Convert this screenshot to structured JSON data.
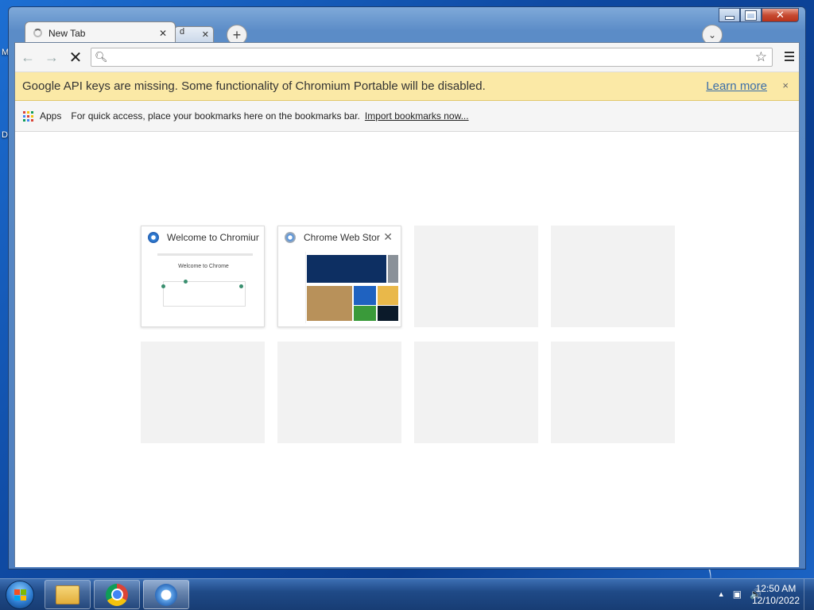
{
  "desktop": {
    "labels": [
      "My",
      "Da"
    ]
  },
  "window": {
    "controls": {
      "minimize": "",
      "maximize": "",
      "close": "✕"
    }
  },
  "tabs": [
    {
      "label": "New Tab",
      "close": "✕"
    },
    {
      "label": "d",
      "close": "✕"
    }
  ],
  "new_tab_button": "+",
  "profile_button": "⌄",
  "toolbar": {
    "back": "←",
    "forward": "→",
    "stop": "✕",
    "address_value": "",
    "star": "☆"
  },
  "infobar": {
    "message": "Google API keys are missing. Some functionality of Chromium Portable will be disabled.",
    "link": "Learn more",
    "close": "×"
  },
  "bookmarks_bar": {
    "apps_label": "Apps",
    "hint": "For quick access, place your bookmarks here on the bookmarks bar.",
    "import_link": "Import bookmarks now..."
  },
  "most_visited": [
    {
      "title": "Welcome to Chromium",
      "thumb_heading": "Welcome to Chrome"
    },
    {
      "title": "Chrome Web Store",
      "close": "✕"
    }
  ],
  "taskbar": {
    "clock_time": "12:50 AM",
    "clock_date": "12/10/2022",
    "tray_arrow": "▲",
    "tray_network": "▣",
    "tray_volume": "🔊"
  },
  "colors": {
    "infobar_bg": "#fbe9a6",
    "link": "#3b6ea8",
    "apps_dots": [
      "#db4437",
      "#f4c20d",
      "#0f9d58",
      "#4285f4",
      "#db4437",
      "#f4c20d",
      "#0f9d58",
      "#4285f4",
      "#db4437"
    ]
  }
}
